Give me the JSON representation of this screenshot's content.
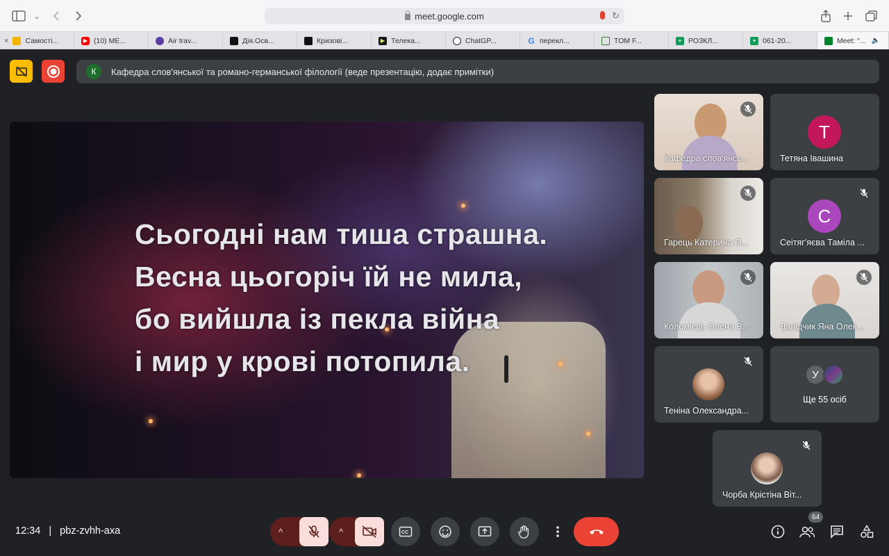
{
  "browser": {
    "url": "meet.google.com",
    "tabs": [
      {
        "label": "Самості...",
        "color": "#f4b400"
      },
      {
        "label": "(10) ME...",
        "color": "#ff0000"
      },
      {
        "label": "Air trav...",
        "color": "#5b3fa0"
      },
      {
        "label": "Дія.Осв...",
        "color": "#111111"
      },
      {
        "label": "Кризові...",
        "color": "#111111"
      },
      {
        "label": "Телека...",
        "color": "#1a1a1a"
      },
      {
        "label": "ChatGP...",
        "color": "#222222"
      },
      {
        "label": "перекл...",
        "color": "#4285f4"
      },
      {
        "label": "TOM F...",
        "color": "#2e7d32"
      },
      {
        "label": "РОЗКЛ...",
        "color": "#0f9d58"
      },
      {
        "label": "061-20...",
        "color": "#0f9d58"
      },
      {
        "label": "Meet: \"...",
        "color": "#00832d"
      }
    ]
  },
  "banner": {
    "initial": "К",
    "text": "Кафедра слов'янської та романо-германської філології (веде презентацію, додає примітки)"
  },
  "slide": {
    "lines": [
      "Сьогодні нам тиша страшна.",
      "Весна цьогоріч їй не мила,",
      "бо вийшла із пекла війна",
      "і мир у крові потопила."
    ]
  },
  "participants": [
    {
      "name": "Кафедра слов'янсь...",
      "type": "video"
    },
    {
      "name": "Тетяна Івашина",
      "initial": "Т",
      "color": "#c2185b",
      "type": "avatar"
    },
    {
      "name": "Гарець Катерина О...",
      "type": "video"
    },
    {
      "name": "Сеітяг'яєва Таміла ...",
      "initial": "С",
      "color": "#ab47bc",
      "type": "avatar"
    },
    {
      "name": "Коломієць Олена В...",
      "type": "video"
    },
    {
      "name": "Давідчик Яна Олек...",
      "type": "video"
    },
    {
      "name": "Теніна Олександра...",
      "type": "photo"
    },
    {
      "name": "Ще 55 осіб",
      "initial": "У",
      "type": "more"
    },
    {
      "name": "Чорба Крістіна Віт...",
      "type": "photo"
    }
  ],
  "footer": {
    "time": "12:34",
    "separator": "|",
    "meeting_code": "pbz-zvhh-axa",
    "people_count": "64"
  },
  "colors": {
    "meet_bg": "#202124",
    "tile_bg": "#3c4043",
    "danger": "#ea4335",
    "muted_ctrl": "#f9dedc",
    "present_icon": "#fbbc04"
  }
}
